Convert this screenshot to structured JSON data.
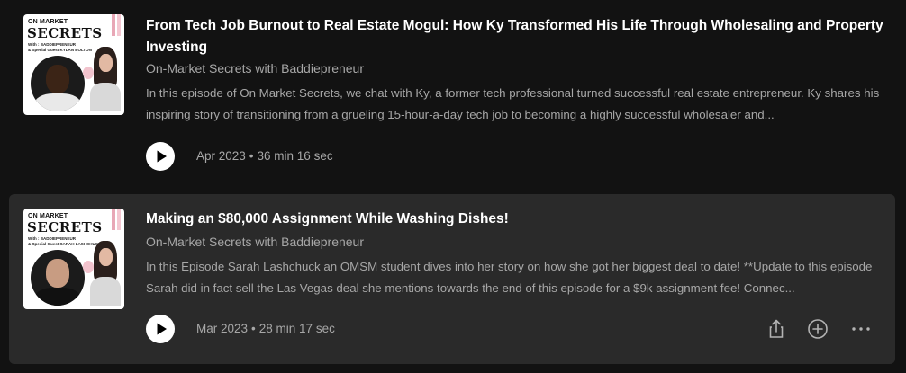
{
  "episodes": [
    {
      "cover": {
        "top_text": "ON MARKET",
        "main_text": "SECRETS",
        "with_text": "With : BADDIEPRENEUR",
        "guest_text": "& Special Guest KYLAN BOLTON"
      },
      "title": "From Tech Job Burnout to Real Estate Mogul: How Ky Transformed His Life Through Wholesaling and Property Investing",
      "show": "On-Market Secrets with Baddiepreneur",
      "description": "In this episode of On Market Secrets, we chat with Ky, a former tech professional turned successful real estate entrepreneur. Ky shares his inspiring story of transitioning from a grueling 15-hour-a-day tech job to becoming a highly successful wholesaler and...",
      "date": "Apr 2023",
      "separator": "•",
      "duration": "36 min 16 sec",
      "play_icon": "play-icon"
    },
    {
      "cover": {
        "top_text": "ON MARKET",
        "main_text": "SECRETS",
        "with_text": "With : BADDIEPRENEUR",
        "guest_text": "& Special Guest SARAH LASHCHUCK"
      },
      "title": "Making an $80,000 Assignment While Washing Dishes!",
      "show": "On-Market Secrets with Baddiepreneur",
      "description": "In this Episode Sarah Lashchuck an OMSM student dives into her story on how she got her biggest deal to date! **Update to this episode Sarah did in fact sell the Las Vegas deal she mentions towards the end of this episode for a $9k assignment fee!  Connec...",
      "date": "Mar 2023",
      "separator": "•",
      "duration": "28 min 17 sec",
      "play_icon": "play-icon",
      "actions": {
        "share_icon": "share-icon",
        "add_icon": "add-circle-icon",
        "more_icon": "more-options-icon"
      }
    }
  ],
  "colors": {
    "background": "#121212",
    "hover_row": "#2a2a2a",
    "primary_text": "#ffffff",
    "secondary_text": "#a7a7a7",
    "cover_accent": "#e8a7b6"
  }
}
